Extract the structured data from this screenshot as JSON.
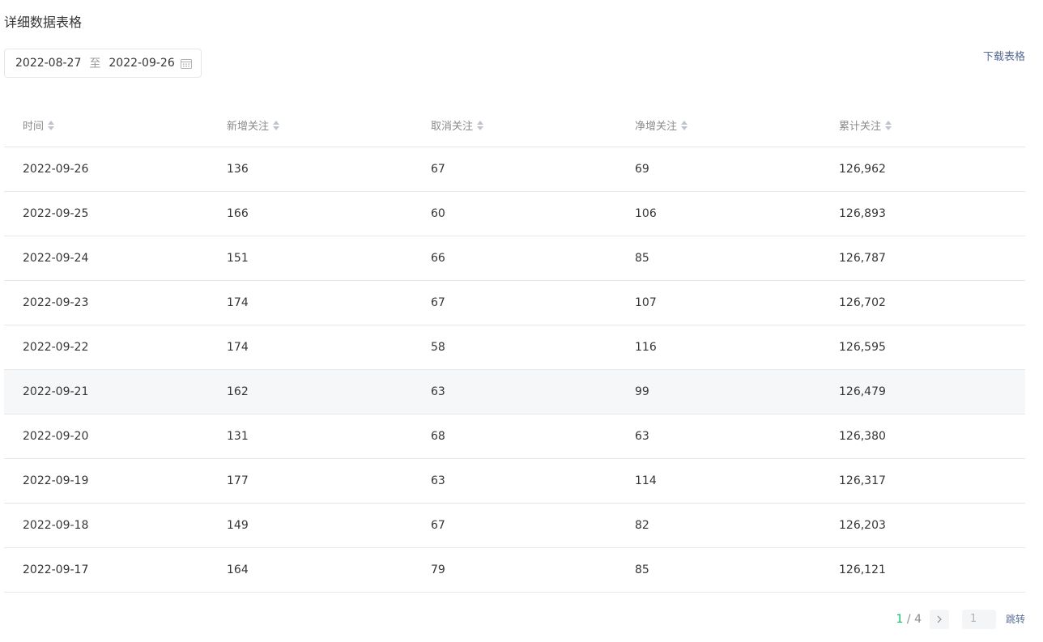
{
  "page": {
    "title": "详细数据表格"
  },
  "date_range": {
    "start": "2022-08-27",
    "separator": "至",
    "end": "2022-09-26"
  },
  "actions": {
    "download_label": "下载表格"
  },
  "table": {
    "columns": [
      "时间",
      "新增关注",
      "取消关注",
      "净增关注",
      "累计关注"
    ],
    "rows": [
      [
        "2022-09-26",
        "136",
        "67",
        "69",
        "126,962"
      ],
      [
        "2022-09-25",
        "166",
        "60",
        "106",
        "126,893"
      ],
      [
        "2022-09-24",
        "151",
        "66",
        "85",
        "126,787"
      ],
      [
        "2022-09-23",
        "174",
        "67",
        "107",
        "126,702"
      ],
      [
        "2022-09-22",
        "174",
        "58",
        "116",
        "126,595"
      ],
      [
        "2022-09-21",
        "162",
        "63",
        "99",
        "126,479"
      ],
      [
        "2022-09-20",
        "131",
        "68",
        "63",
        "126,380"
      ],
      [
        "2022-09-19",
        "177",
        "63",
        "114",
        "126,317"
      ],
      [
        "2022-09-18",
        "149",
        "67",
        "82",
        "126,203"
      ],
      [
        "2022-09-17",
        "164",
        "79",
        "85",
        "126,121"
      ]
    ],
    "highlighted_row": 5
  },
  "pagination": {
    "current": "1",
    "separator": " / ",
    "total": "4",
    "input_placeholder": "1",
    "jump_label": "跳转"
  },
  "icons": {
    "calendar": "calendar-icon",
    "sort": "sort-icon",
    "next": "chevron-right-icon"
  },
  "colors": {
    "link": "#576b95",
    "current_page": "#07c160",
    "row_highlight": "#f6f7f9"
  }
}
